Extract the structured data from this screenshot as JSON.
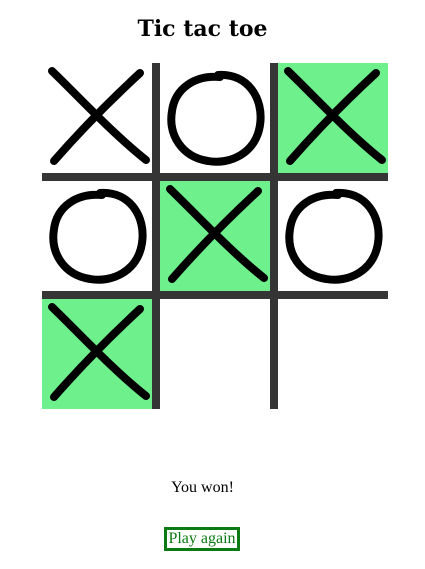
{
  "title": "Tic tac toe",
  "board": [
    {
      "mark": "X",
      "highlight": false
    },
    {
      "mark": "O",
      "highlight": false
    },
    {
      "mark": "X",
      "highlight": true
    },
    {
      "mark": "O",
      "highlight": false
    },
    {
      "mark": "X",
      "highlight": true
    },
    {
      "mark": "O",
      "highlight": false
    },
    {
      "mark": "X",
      "highlight": true
    },
    {
      "mark": "",
      "highlight": false
    },
    {
      "mark": "",
      "highlight": false
    }
  ],
  "status": "You won!",
  "play_again_label": "Play again",
  "colors": {
    "highlight": "#6ef08c",
    "grid": "#353535",
    "mark": "#000000",
    "button": "#0a7a12"
  }
}
